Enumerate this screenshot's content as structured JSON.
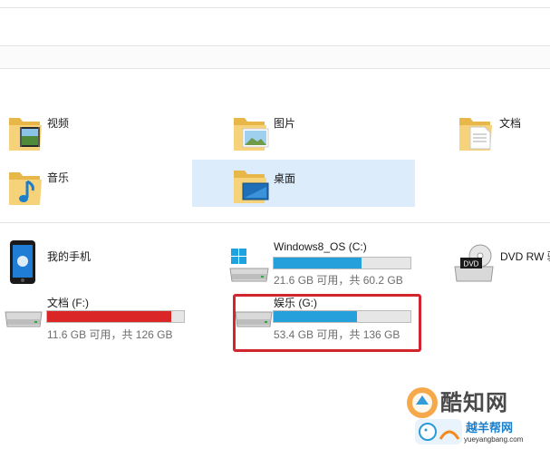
{
  "folders": [
    {
      "label": "视频",
      "icon": "videos-folder-icon"
    },
    {
      "label": "图片",
      "icon": "pictures-folder-icon"
    },
    {
      "label": "文档",
      "icon": "documents-folder-icon"
    },
    {
      "label": "音乐",
      "icon": "music-folder-icon"
    },
    {
      "label": "桌面",
      "icon": "desktop-folder-icon"
    }
  ],
  "devices": {
    "phone": {
      "label": "我的手机",
      "icon": "phone-icon"
    },
    "drive_c": {
      "label": "Windows8_OS (C:)",
      "capacity": "21.6 GB 可用，共 60.2 GB",
      "used_fraction": 0.64,
      "bar_color": "#26a0da"
    },
    "dvd": {
      "label": "DVD RW 驱",
      "icon_text": "DVD"
    },
    "drive_f": {
      "label": "文档 (F:)",
      "capacity": "11.6 GB 可用，共 126 GB",
      "used_fraction": 0.91,
      "bar_color": "#da2626"
    },
    "drive_g": {
      "label": "娱乐 (G:)",
      "capacity": "53.4 GB 可用，共 136 GB",
      "used_fraction": 0.61,
      "bar_color": "#26a0da"
    }
  },
  "highlight_color": "#d2262e",
  "watermark": {
    "brand": "酷知网",
    "site": "yueyangbang.com",
    "logo_text": "越羊帮网"
  }
}
